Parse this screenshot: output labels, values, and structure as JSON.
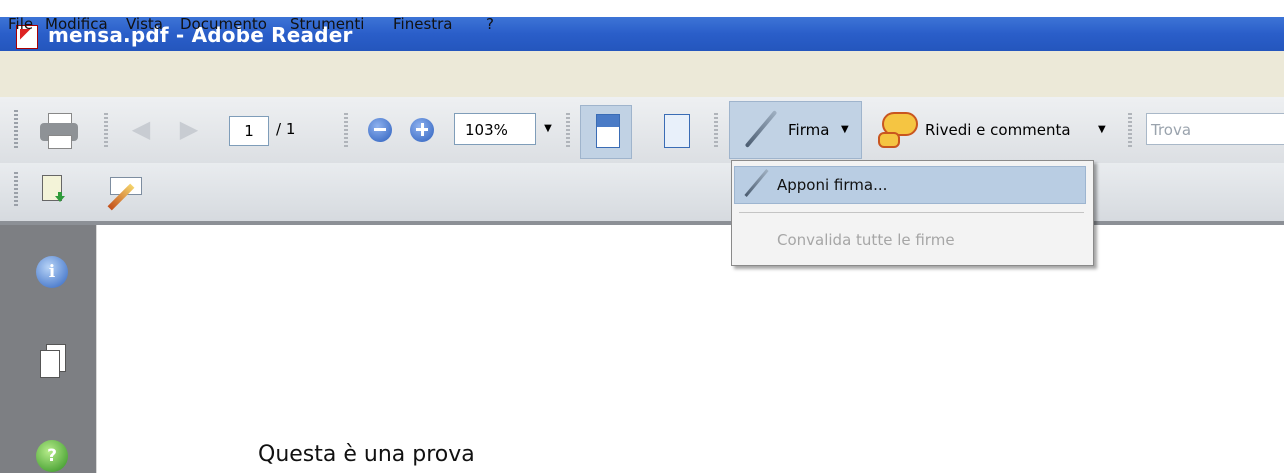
{
  "window": {
    "title": "mensa.pdf - Adobe Reader"
  },
  "menubar": [
    "File",
    "Modifica",
    "Vista",
    "Documento",
    "Strumenti",
    "Finestra",
    "?"
  ],
  "toolbar": {
    "page_current": "1",
    "page_total": "/ 1",
    "zoom": "103%",
    "firma_label": "Firma",
    "rivedi_label": "Rivedi e commenta",
    "search_placeholder": "Trova"
  },
  "dropdown": {
    "items": [
      {
        "label": "Apponi firma...",
        "enabled": true,
        "highlighted": true
      },
      {
        "label": "Convalida tutte le firme",
        "enabled": false
      }
    ]
  },
  "document": {
    "text": "Questa è una prova"
  },
  "colors": {
    "titlebar": "#2a5ec9",
    "menubar": "#ece9d8",
    "sidepanel": "#7d7f83",
    "highlight": "#b9cde3"
  }
}
